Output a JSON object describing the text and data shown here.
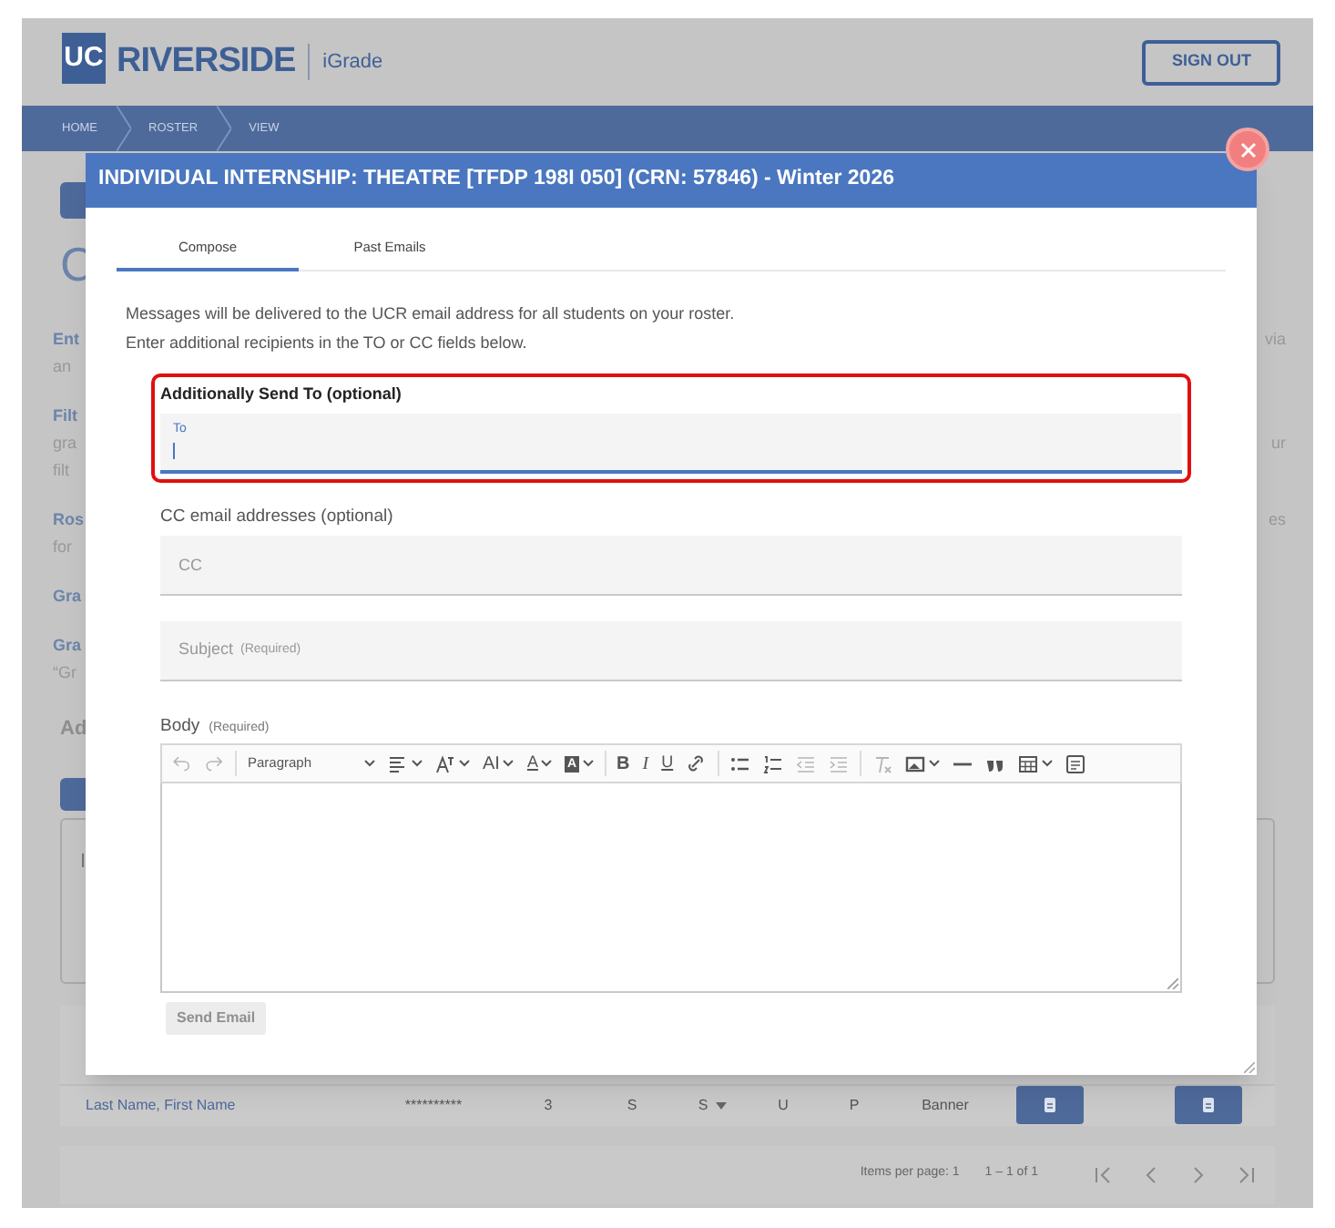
{
  "header": {
    "logo_mark": "UC",
    "logo_text": "RIVERSIDE",
    "app_name": "iGrade",
    "sign_out": "SIGN OUT"
  },
  "breadcrumbs": [
    "HOME",
    "ROSTER",
    "VIEW"
  ],
  "background": {
    "heading": "C",
    "groups": [
      [
        {
          "left": "Ent",
          "right": "via"
        },
        {
          "left": "an"
        }
      ],
      [
        {
          "left": "Filt"
        },
        {
          "left": "gra",
          "right": "ur"
        },
        {
          "left": "filt"
        }
      ],
      [
        {
          "left": "Ros",
          "right": "es"
        },
        {
          "left": "for"
        }
      ],
      [
        {
          "left": "Gra"
        }
      ],
      [
        {
          "left": "Gra"
        },
        {
          "left": "“Gr"
        }
      ]
    ],
    "subheading": "Ad",
    "card_fragment": "I",
    "row": {
      "name": "Last Name, First Name",
      "cells": [
        {
          "text": "**********",
          "kind": "plain"
        },
        {
          "text": "3",
          "kind": "plain"
        },
        {
          "text": "S",
          "kind": "plain"
        },
        {
          "text": "S",
          "kind": "select"
        },
        {
          "text": "U",
          "kind": "plain"
        },
        {
          "text": "P",
          "kind": "plain"
        },
        {
          "text": "Banner",
          "kind": "plain"
        }
      ]
    },
    "pagination": {
      "items_per_page": "Items per page: 1",
      "range": "1 – 1 of 1"
    }
  },
  "dialog": {
    "title": "INDIVIDUAL INTERNSHIP: THEATRE [TFDP 198I 050] (CRN: 57846) - Winter 2026",
    "tabs": [
      {
        "label": "Compose",
        "selected": true
      },
      {
        "label": "Past Emails",
        "selected": false
      }
    ],
    "intro": [
      "Messages will be delivered to the UCR email address for all students on your roster.",
      "Enter additional recipients in the TO or CC fields below."
    ],
    "to": {
      "label": "Additionally Send To (optional)",
      "field_label": "To",
      "focused": true,
      "highlighted": true
    },
    "cc": {
      "label": "CC email addresses (optional)",
      "placeholder": "CC"
    },
    "subject": {
      "placeholder": "Subject",
      "note": "(Required)"
    },
    "body": {
      "label": "Body",
      "note": "(Required)"
    },
    "toolbar": [
      {
        "kind": "undo",
        "disabled": true
      },
      {
        "kind": "redo",
        "disabled": true
      },
      {
        "kind": "separator"
      },
      {
        "kind": "heading",
        "label": "Paragraph",
        "disabled": false
      },
      {
        "kind": "align",
        "disabled": false
      },
      {
        "kind": "font-family",
        "disabled": false
      },
      {
        "kind": "font-size",
        "glyph": "AI",
        "disabled": false
      },
      {
        "kind": "font-color",
        "glyph": "A",
        "disabled": false
      },
      {
        "kind": "highlight",
        "glyph": "A",
        "disabled": false
      },
      {
        "kind": "separator"
      },
      {
        "kind": "bold",
        "glyph": "B",
        "disabled": false
      },
      {
        "kind": "italic",
        "glyph": "I",
        "disabled": false
      },
      {
        "kind": "underline",
        "glyph": "U",
        "disabled": false
      },
      {
        "kind": "link",
        "disabled": false
      },
      {
        "kind": "separator"
      },
      {
        "kind": "bullets",
        "disabled": false
      },
      {
        "kind": "numbers",
        "disabled": false
      },
      {
        "kind": "outdent",
        "disabled": true
      },
      {
        "kind": "indent",
        "disabled": true
      },
      {
        "kind": "separator"
      },
      {
        "kind": "clear-format",
        "disabled": true
      },
      {
        "kind": "image",
        "disabled": false
      },
      {
        "kind": "rule",
        "disabled": false
      },
      {
        "kind": "quote",
        "disabled": false
      },
      {
        "kind": "table",
        "disabled": false
      },
      {
        "kind": "source",
        "disabled": false
      }
    ],
    "send": {
      "label": "Send Email",
      "disabled": true
    }
  }
}
